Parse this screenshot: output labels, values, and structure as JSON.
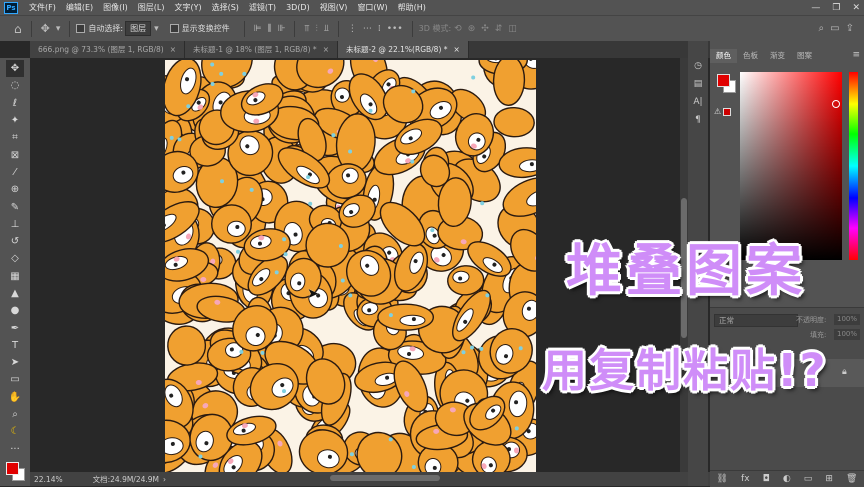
{
  "menubar": {
    "logo": "Ps",
    "items": [
      "文件(F)",
      "编辑(E)",
      "图像(I)",
      "图层(L)",
      "文字(Y)",
      "选择(S)",
      "滤镜(T)",
      "3D(D)",
      "视图(V)",
      "窗口(W)",
      "帮助(H)"
    ],
    "window_controls": [
      "—",
      "❐",
      "✕"
    ]
  },
  "options_bar": {
    "auto_select_label": "自动选择:",
    "auto_select_value": "图层",
    "show_transform_label": "显示变换控件",
    "mode_3d_label": "3D 模式:"
  },
  "tabs": [
    {
      "label": "666.png @ 73.3% (图层 1, RGB/8)",
      "close": "×",
      "active": false
    },
    {
      "label": "未标题-1 @ 18% (图层 1, RGB/8) *",
      "close": "×",
      "active": false
    },
    {
      "label": "未标题-2 @ 22.1%(RGB/8) *",
      "close": "×",
      "active": true
    }
  ],
  "status": {
    "zoom": "22.14%",
    "doc_size": "文档:24.9M/24.9M"
  },
  "panels": {
    "tabs": [
      "颜色",
      "色板",
      "渐变",
      "图案"
    ],
    "color_fg": "#e00000",
    "color_bg": "#ffffff",
    "blend_mode": "正常",
    "opacity_label": "不透明度:",
    "opacity_value": "100%",
    "fill_label": "填充:",
    "fill_value": "100%"
  },
  "overlay": {
    "title_line1": "堆叠图案",
    "title_line2": "用复制粘贴!?"
  },
  "colors": {
    "chrome": "#535353",
    "workspace": "#282828",
    "accent_text": "#cf8df8",
    "shiba_orange": "#f0a030"
  }
}
